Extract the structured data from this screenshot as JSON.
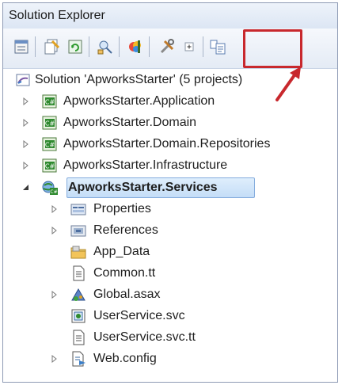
{
  "window": {
    "title": "Solution Explorer"
  },
  "toolbar": {
    "buttons": [
      {
        "name": "properties-icon"
      },
      {
        "name": "show-all-files-icon"
      },
      {
        "name": "refresh-icon"
      },
      {
        "name": "view-class-diagram-icon"
      },
      {
        "name": "nested-related-files-icon"
      },
      {
        "name": "build-settings-icon"
      },
      {
        "name": "expand-icon"
      },
      {
        "name": "view-code-icon"
      }
    ]
  },
  "tree": {
    "solution": {
      "label": "Solution 'ApworksStarter' (5 projects)"
    },
    "projects": [
      {
        "label": "ApworksStarter.Application"
      },
      {
        "label": "ApworksStarter.Domain"
      },
      {
        "label": "ApworksStarter.Domain.Repositories"
      },
      {
        "label": "ApworksStarter.Infrastructure"
      }
    ],
    "services": {
      "label": "ApworksStarter.Services",
      "children": [
        {
          "label": "Properties"
        },
        {
          "label": "References"
        },
        {
          "label": "App_Data"
        },
        {
          "label": "Common.tt"
        },
        {
          "label": "Global.asax"
        },
        {
          "label": "UserService.svc"
        },
        {
          "label": "UserService.svc.tt"
        },
        {
          "label": "Web.config"
        }
      ]
    }
  },
  "colors": {
    "highlight": "#c8282d",
    "selection": "#c4ddf7",
    "csharp_green": "#2f8a2f"
  }
}
